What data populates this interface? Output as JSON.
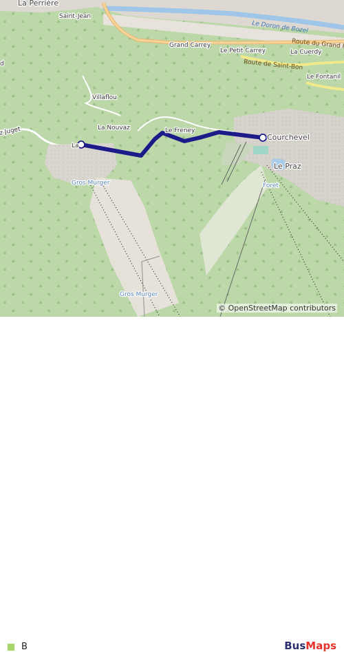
{
  "map": {
    "places": {
      "la_perriere": "La Perrière",
      "saint_jean": "Saint-Jean",
      "grand_carrey": "Grand Carrey",
      "le_petit_carrey": "Le Petit Carrey",
      "la_cuerdy": "La Cuerdy",
      "le_fontanil": "Le Fontanil",
      "villaflou": "Villaflou",
      "la_nouvaz": "La Nouvaz",
      "le_freney": "Le Freney",
      "courchevel_le_praz": [
        "Courchevel",
        "Le Praz"
      ],
      "foret": "Foret",
      "gros_murger_top": "Gros Murger",
      "gros_murger_bottom": "Gros Murger",
      "la_fragment": "La",
      "juget_fragment": "z Juget",
      "left_edge_fragment": "d"
    },
    "roads": {
      "river": "Le Doron de Bozel",
      "route_grand_p": "Route du Grand P",
      "route_saint_bon": "Route de Saint-Bon"
    },
    "route": {
      "line_color": "#1d1b8a",
      "stop_color": "#ffffff",
      "stop_border": "#1d1b8a",
      "origin": "La Tania",
      "destination": "Courchevel Le Praz"
    },
    "attribution": "© OpenStreetMap contributors"
  },
  "legend": {
    "swatch_color": "#a6d66a",
    "label": "B"
  },
  "brand": {
    "part1": "Bus",
    "part2": "Maps"
  }
}
